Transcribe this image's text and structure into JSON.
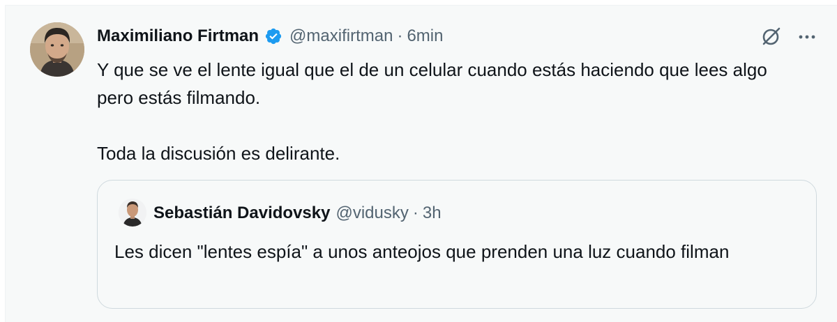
{
  "tweet": {
    "author_name": "Maximiliano Firtman",
    "handle": "@maxifirtman",
    "separator": "·",
    "time": "6min",
    "text_paragraphs": [
      "Y que se ve el lente igual que el de un celular cuando estás haciendo que lees algo pero estás filmando.",
      "Toda la discusión es delirante."
    ],
    "verified_color": "#1d9bf0",
    "icons": {
      "verified": "verified-badge-icon",
      "grok": "grok-icon",
      "more": "more-options-icon"
    }
  },
  "quoted_tweet": {
    "author_name": "Sebastián Davidovsky",
    "handle": "@vidusky",
    "separator": "·",
    "time": "3h",
    "text": "Les dicen \"lentes espía\" a unos anteojos que prenden una luz cuando filman"
  },
  "colors": {
    "background": "#f7f9f9",
    "text_primary": "#0f1419",
    "text_secondary": "#536471",
    "border": "#cfd9de"
  }
}
